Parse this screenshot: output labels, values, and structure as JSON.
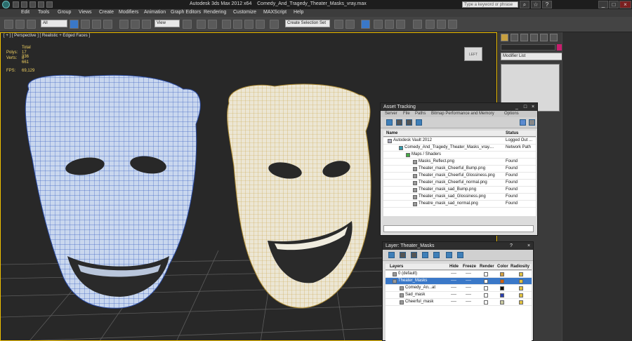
{
  "window": {
    "app_title": "Autodesk 3ds Max  2012 x64",
    "file_title": "Comedy_And_Tragedy_Theater_Masks_vray.max",
    "search_placeholder": "Type a keyword or phrase"
  },
  "menu": [
    "Edit",
    "Tools",
    "Group",
    "Views",
    "Create",
    "Modifiers",
    "Animation",
    "Graph Editors",
    "Rendering",
    "Customize",
    "MAXScript",
    "Help"
  ],
  "toolbar": {
    "selection_filter": "All",
    "coordinate_system": "View",
    "named_selection": "Create Selection Set"
  },
  "viewport": {
    "label": "[ + ] [ Perspective ] [ Realistic + Edged Faces ]",
    "stats_header": "Total",
    "polys_label": "Polys:",
    "polys_value": "17 336",
    "verts_label": "Verts:",
    "verts_value": "8 661",
    "fps_label": "FPS:",
    "fps_value": "69,129",
    "viewcube_label": "LEFT",
    "colors": {
      "mask_left": "#c8d8f0",
      "mask_left_wire": "#3a5fc0",
      "mask_right": "#ece8dc",
      "mask_right_wire": "#c8a94a",
      "grid": "#6a6a6a"
    }
  },
  "command_panel": {
    "modifier_list": "Modifier List"
  },
  "asset_tracking": {
    "title": "Asset Tracking",
    "menu": [
      "Server",
      "File",
      "Paths",
      "Bitmap Performance and Memory",
      "Options"
    ],
    "columns": {
      "name": "Name",
      "status": "Status"
    },
    "rows": [
      {
        "name": "Autodesk Vault 2012",
        "status": "Logged Out ..."
      },
      {
        "name": "Comedy_And_Tragedy_Theater_Masks_vray....",
        "status": "Network Path"
      },
      {
        "name": "Maps / Shaders",
        "status": ""
      },
      {
        "name": "Masks_Reflect.png",
        "status": "Found"
      },
      {
        "name": "Theater_mask_Cheerful_Bump.png",
        "status": "Found"
      },
      {
        "name": "Theater_mask_Cheerful_Glossiness.png",
        "status": "Found"
      },
      {
        "name": "Theater_mask_Cheerful_normal.png",
        "status": "Found"
      },
      {
        "name": "Theater_mask_sad_Bump.png",
        "status": "Found"
      },
      {
        "name": "Theater_mask_sad_Glossiness.png",
        "status": "Found"
      },
      {
        "name": "Theatre_mask_sad_normal.png",
        "status": "Found"
      }
    ]
  },
  "layer_panel": {
    "title": "Layer: Theater_Masks",
    "columns": {
      "layers": "Layers",
      "hide": "Hide",
      "freeze": "Freeze",
      "render": "Render",
      "color": "Color",
      "radiosity": "Radiosity"
    },
    "rows": [
      {
        "name": "0 (default)",
        "hide": "----",
        "freeze": "----",
        "color": "#d4a040"
      },
      {
        "name": "Theater_Masks",
        "hide": "----",
        "freeze": "----",
        "color": "#d06010"
      },
      {
        "name": "Comedy_An...at",
        "hide": "----",
        "freeze": "----",
        "color": "#111111"
      },
      {
        "name": "Sad_mask",
        "hide": "----",
        "freeze": "----",
        "color": "#2a3fb0"
      },
      {
        "name": "Cheerful_mask",
        "hide": "----",
        "freeze": "----",
        "color": "#c8c8a0"
      }
    ]
  }
}
